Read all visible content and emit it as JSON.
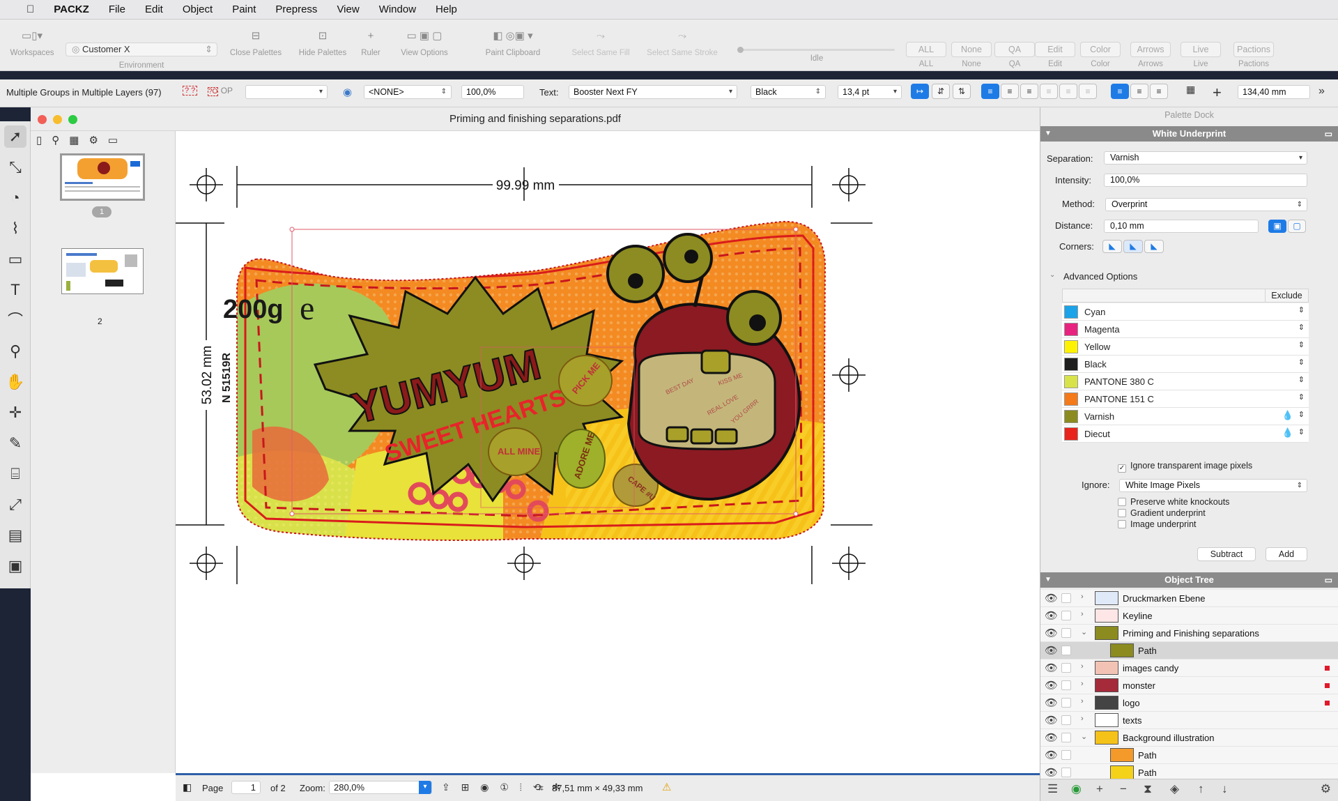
{
  "menubar": {
    "app": "PACKZ",
    "items": [
      "File",
      "Edit",
      "Object",
      "Paint",
      "Prepress",
      "View",
      "Window",
      "Help"
    ]
  },
  "toolbar": {
    "workspaces": "Workspaces",
    "environment_value": "Customer X",
    "environment": "Environment",
    "close_palettes": "Close Palettes",
    "hide_palettes": "Hide Palettes",
    "ruler": "Ruler",
    "view_options": "View Options",
    "paint_clipboard": "Paint Clipboard",
    "select_same_fill": "Select Same Fill",
    "select_same_stroke": "Select Same Stroke",
    "idle": "Idle",
    "segments": [
      {
        "button": "ALL",
        "label": "ALL"
      },
      {
        "button": "None",
        "label": "None"
      },
      {
        "button": "QA",
        "label": "QA"
      },
      {
        "button": "Edit",
        "label": "Edit"
      },
      {
        "button": "Color",
        "label": "Color"
      },
      {
        "button": "Arrows",
        "label": "Arrows"
      },
      {
        "button": "Live",
        "label": "Live"
      },
      {
        "button": "Pactions",
        "label": "Pactions"
      }
    ]
  },
  "options": {
    "selection_info": "Multiple Groups in Multiple Layers (97)",
    "op": "OP",
    "swatch": "<NONE>",
    "opacity": "100,0%",
    "text_label": "Text:",
    "font": "Booster Next FY",
    "style": "Black",
    "size": "13,4 pt",
    "width": "134,40 mm"
  },
  "document": {
    "title": "Priming and finishing separations.pdf",
    "pages": [
      {
        "label": "1"
      },
      {
        "label": "2"
      }
    ]
  },
  "artwork": {
    "dimension_width": "99.99 mm",
    "dimension_height": "53.02 mm",
    "weight": "200g",
    "estimated_sign": "e",
    "barcode_text": "N 51519R",
    "brand": "YUMYUM",
    "subtitle": "SWEET HEARTS",
    "hearts": [
      "PICK ME",
      "ALL MINE",
      "ADORE ME",
      "CAPE #U"
    ],
    "candy_texts": [
      "BEST DAY",
      "KISS ME",
      "REAL LOVE",
      "YOU GRRR"
    ]
  },
  "status": {
    "page_label": "Page",
    "page": "1",
    "of": "of 2",
    "zoom_label": "Zoom:",
    "zoom": "280,0%",
    "dims": "87,51 mm × 49,33 mm"
  },
  "palette": {
    "dock": "Palette Dock",
    "panel_title": "White Underprint",
    "separation_label": "Separation:",
    "separation": "Varnish",
    "intensity_label": "Intensity:",
    "intensity": "100,0%",
    "method_label": "Method:",
    "method": "Overprint",
    "distance_label": "Distance:",
    "distance": "0,10 mm",
    "corners_label": "Corners:",
    "advanced": "Advanced Options",
    "exclude": "Exclude",
    "colors": [
      {
        "name": "Cyan",
        "color": "#1aa3e8"
      },
      {
        "name": "Magenta",
        "color": "#e8237f"
      },
      {
        "name": "Yellow",
        "color": "#fff200"
      },
      {
        "name": "Black",
        "color": "#1f1f1f"
      },
      {
        "name": "PANTONE 380 C",
        "color": "#d8e34a"
      },
      {
        "name": "PANTONE 151 C",
        "color": "#f47a1a"
      },
      {
        "name": "Varnish",
        "color": "#8b8b20"
      },
      {
        "name": "Diecut",
        "color": "#e8241c"
      }
    ],
    "ignore_transparent": "Ignore transparent image pixels",
    "ignore_label": "Ignore:",
    "ignore_value": "White Image Pixels",
    "preserve_knockouts": "Preserve white knockouts",
    "gradient_underprint": "Gradient underprint",
    "image_underprint": "Image underprint",
    "subtract": "Subtract",
    "add": "Add"
  },
  "object_tree": {
    "title": "Object Tree",
    "rows": [
      {
        "name": "Druckmarken Ebene",
        "level": 0,
        "expanded": false,
        "flag": false,
        "thumb": "#dfe9f7"
      },
      {
        "name": "Keyline",
        "level": 0,
        "expanded": false,
        "flag": false,
        "thumb": "#ffe6e6"
      },
      {
        "name": "Priming and Finishing separations",
        "level": 0,
        "expanded": true,
        "flag": false,
        "thumb": "#8b8b20"
      },
      {
        "name": "Path",
        "level": 1,
        "expanded": false,
        "flag": false,
        "thumb": "#8b8b20"
      },
      {
        "name": "images candy",
        "level": 0,
        "expanded": false,
        "flag": true,
        "thumb": "#f2c3b5"
      },
      {
        "name": "monster",
        "level": 0,
        "expanded": false,
        "flag": true,
        "thumb": "#a52a3a"
      },
      {
        "name": "logo",
        "level": 0,
        "expanded": false,
        "flag": true,
        "thumb": "#444444"
      },
      {
        "name": "texts",
        "level": 0,
        "expanded": false,
        "flag": false,
        "thumb": "#ffffff"
      },
      {
        "name": "Background illustration",
        "level": 0,
        "expanded": true,
        "flag": false,
        "thumb": "#f5c21a"
      },
      {
        "name": "Path",
        "level": 1,
        "expanded": false,
        "flag": false,
        "thumb": "#f39a2a"
      },
      {
        "name": "Path",
        "level": 1,
        "expanded": false,
        "flag": false,
        "thumb": "#f5d21a"
      }
    ]
  }
}
